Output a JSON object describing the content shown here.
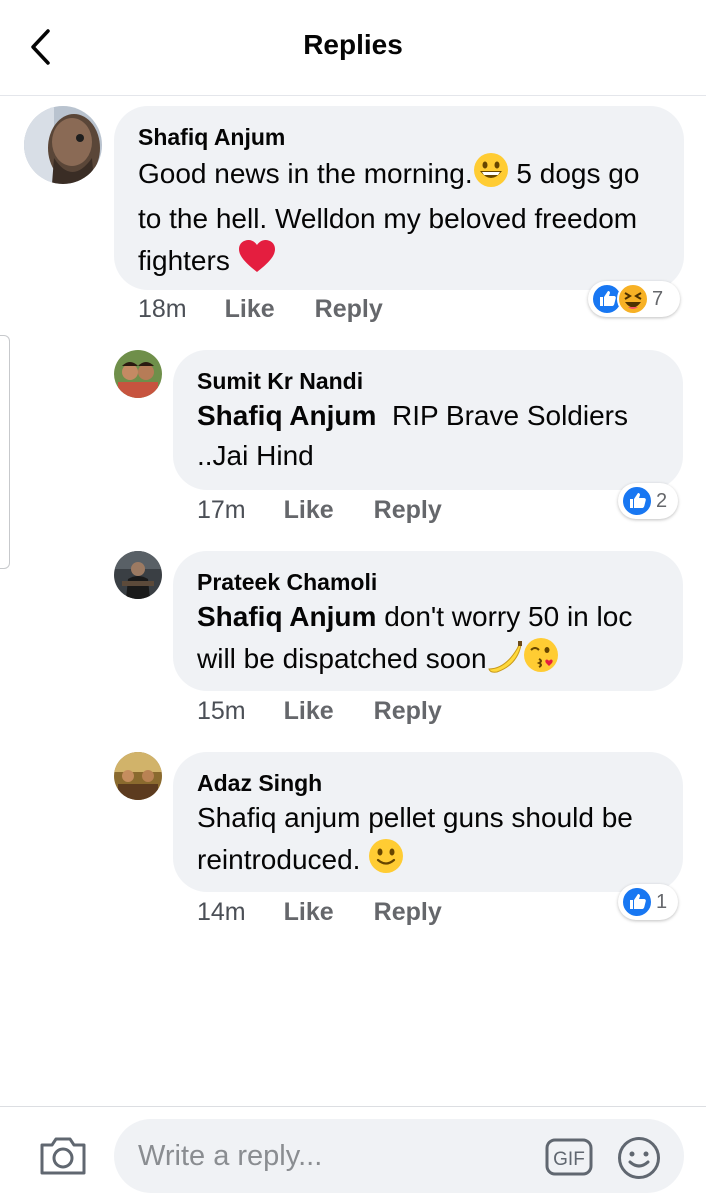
{
  "header": {
    "title": "Replies",
    "back_icon": "chevron-left-icon"
  },
  "comments": [
    {
      "author": "Shafiq Anjum",
      "text": "Good news in the morning.",
      "text_mid": " 5 dogs go to the hell. Welldon my beloved freedom fighters ",
      "time": "18m",
      "like": "Like",
      "reply": "Reply",
      "reaction_icons": [
        "like-icon",
        "haha-icon"
      ],
      "reaction_count": "7"
    },
    {
      "author": "Sumit Kr Nandi",
      "mention": "Shafiq Anjum",
      "text": "RIP Brave Soldiers ..Jai Hind",
      "time": "17m",
      "like": "Like",
      "reply": "Reply",
      "reaction_icons": [
        "like-icon"
      ],
      "reaction_count": "2"
    },
    {
      "author": "Prateek Chamoli",
      "mention": "Shafiq Anjum",
      "text": "don't worry 50 in loc will be dispatched soon",
      "time": "15m",
      "like": "Like",
      "reply": "Reply"
    },
    {
      "author": "Adaz Singh",
      "text": "Shafiq anjum pellet guns should be reintroduced. ",
      "time": "14m",
      "like": "Like",
      "reply": "Reply",
      "reaction_icons": [
        "like-icon"
      ],
      "reaction_count": "1"
    }
  ],
  "composer": {
    "placeholder": "Write a reply...",
    "gif_label": "GIF",
    "camera_icon": "camera-icon",
    "emoji_icon": "smile-icon"
  },
  "colors": {
    "accent": "#1877f2",
    "bubble": "#f0f2f5",
    "meta": "#65676b",
    "heart": "#e41e3f"
  }
}
